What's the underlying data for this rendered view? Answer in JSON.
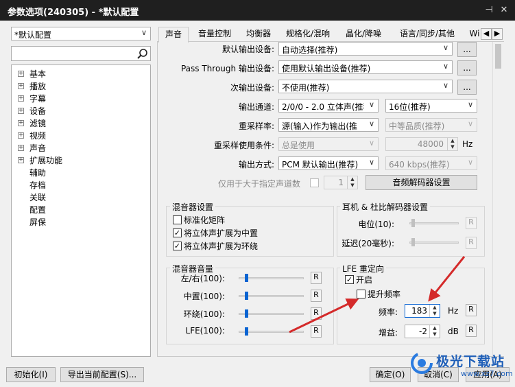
{
  "window": {
    "title": "参数选项(240305) - *默认配置",
    "pin": "⊣",
    "close": "✕"
  },
  "profile": {
    "selected": "*默认配置"
  },
  "search": {
    "value": "",
    "placeholder": ""
  },
  "tree": [
    {
      "label": "基本",
      "expandable": true
    },
    {
      "label": "播放",
      "expandable": true
    },
    {
      "label": "字幕",
      "expandable": true
    },
    {
      "label": "设备",
      "expandable": true
    },
    {
      "label": "滤镜",
      "expandable": true
    },
    {
      "label": "视频",
      "expandable": true
    },
    {
      "label": "声音",
      "expandable": true
    },
    {
      "label": "扩展功能",
      "expandable": true
    },
    {
      "label": "辅助",
      "expandable": false
    },
    {
      "label": "存档",
      "expandable": false
    },
    {
      "label": "关联",
      "expandable": false
    },
    {
      "label": "配置",
      "expandable": false
    },
    {
      "label": "屏保",
      "expandable": false
    }
  ],
  "tabs": [
    "声音",
    "音量控制",
    "均衡器",
    "规格化/混响",
    "晶化/降噪",
    "语言/同步/其他",
    "Wi"
  ],
  "tab_scroll": {
    "left": "◀",
    "right": "▶"
  },
  "output": {
    "default_device_label": "默认输出设备:",
    "default_device_value": "自动选择(推荐)",
    "passthrough_label": "Pass Through 输出设备:",
    "passthrough_value": "使用默认输出设备(推荐)",
    "secondary_label": "次输出设备:",
    "secondary_value": "不使用(推荐)",
    "more_button": "...",
    "channel_label": "输出通道:",
    "channel_value": "2/0/0 - 2.0 立体声(推荐",
    "bitdepth_value": "16位(推荐)",
    "resample_label": "重采样率:",
    "resample_value": "源(输入)作为输出(推",
    "quality_value": "中等品质(推荐)",
    "resample_cond_label": "重采样使用条件:",
    "resample_cond_value": "总是使用",
    "rate_value": "48000",
    "rate_unit": "Hz",
    "method_label": "输出方式:",
    "method_value": "PCM 默认输出(推荐)",
    "bitrate_value": "640 kbps(推荐)",
    "channels_only_label": "仅用于大于指定声道数",
    "channels_only_value": "1",
    "decoder_button": "音频解码器设置"
  },
  "mixer_settings": {
    "title": "混音器设置",
    "items": [
      {
        "label": "标准化矩阵",
        "checked": false
      },
      {
        "label": "将立体声扩展为中置",
        "checked": true
      },
      {
        "label": "将立体声扩展为环绕",
        "checked": true
      }
    ]
  },
  "headphone": {
    "title": "耳机 & 杜比解码器设置",
    "level_label": "电位(10):",
    "delay_label": "延迟(20毫秒):",
    "reset": "R"
  },
  "mixer_volume": {
    "title": "混音器音量",
    "rows": [
      {
        "label": "左/右(100):",
        "level": 0.12
      },
      {
        "label": "中置(100):",
        "level": 0.12
      },
      {
        "label": "环绕(100):",
        "level": 0.12
      },
      {
        "label": "LFE(100):",
        "level": 0.12
      }
    ],
    "reset": "R"
  },
  "lfe": {
    "title": "LFE 重定向",
    "enable_label": "开启",
    "enable_checked": true,
    "boost_label": "提升频率",
    "boost_checked": false,
    "freq_label": "频率:",
    "freq_value": "183",
    "freq_unit": "Hz",
    "gain_label": "增益:",
    "gain_value": "-2",
    "gain_unit": "dB",
    "reset": "R"
  },
  "footer": {
    "init_button": "初始化(I)",
    "export_button": "导出当前配置(S)...",
    "ok_button": "确定(O)",
    "cancel_button": "取消(C)",
    "apply_button": "应用(A)"
  },
  "watermark": {
    "brand": "极光下载站",
    "url": "www.xz7.com"
  },
  "colors": {
    "accent": "#0a64d2",
    "arrow": "#d42a2a",
    "titlebar": "#1f1f1f"
  }
}
